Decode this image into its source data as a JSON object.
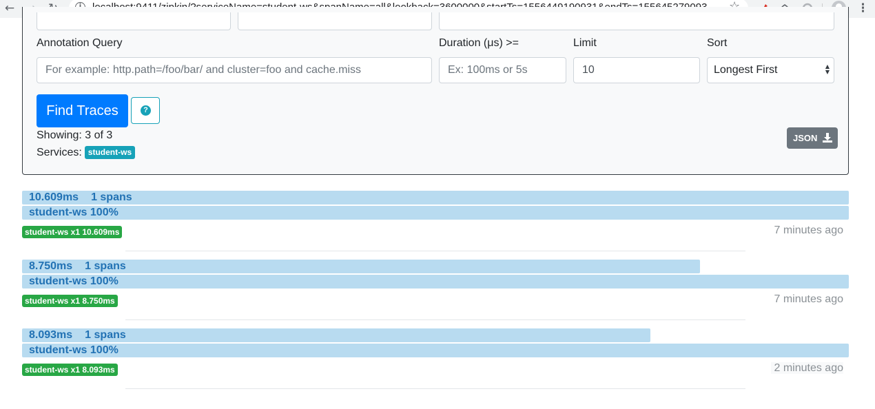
{
  "browser": {
    "url": "localhost:9411/zipkin/?serviceName=student-ws&spanName=all&lookback=3600000&startTs=1556449190931&endTs=155645279093..."
  },
  "search": {
    "annotation_label": "Annotation Query",
    "annotation_placeholder": "For example: http.path=/foo/bar/ and cluster=foo and cache.miss",
    "duration_label": "Duration (μs) >=",
    "duration_placeholder": "Ex: 100ms or 5s",
    "limit_label": "Limit",
    "limit_value": "10",
    "sort_label": "Sort",
    "sort_value": "Longest First",
    "find_button": "Find Traces",
    "showing": "Showing: 3 of 3",
    "services_label": "Services:",
    "service_badge": "student-ws",
    "json_button": "JSON"
  },
  "traces": [
    {
      "duration": "10.609ms",
      "spans": "1 spans",
      "bar_fraction": 1.0,
      "service_line": "student-ws 100%",
      "tag": "student-ws x1 10.609ms",
      "ago": "7 minutes ago"
    },
    {
      "duration": "8.750ms",
      "spans": "1 spans",
      "bar_fraction": 0.82,
      "service_line": "student-ws 100%",
      "tag": "student-ws x1 8.750ms",
      "ago": "7 minutes ago"
    },
    {
      "duration": "8.093ms",
      "spans": "1 spans",
      "bar_fraction": 0.76,
      "service_line": "student-ws 100%",
      "tag": "student-ws x1 8.093ms",
      "ago": "2 minutes ago"
    }
  ],
  "colors": {
    "primary": "#007bff",
    "info": "#17a2b8",
    "success": "#28a745",
    "bar": "#b8dbf0",
    "bar_text": "#2272b4"
  }
}
